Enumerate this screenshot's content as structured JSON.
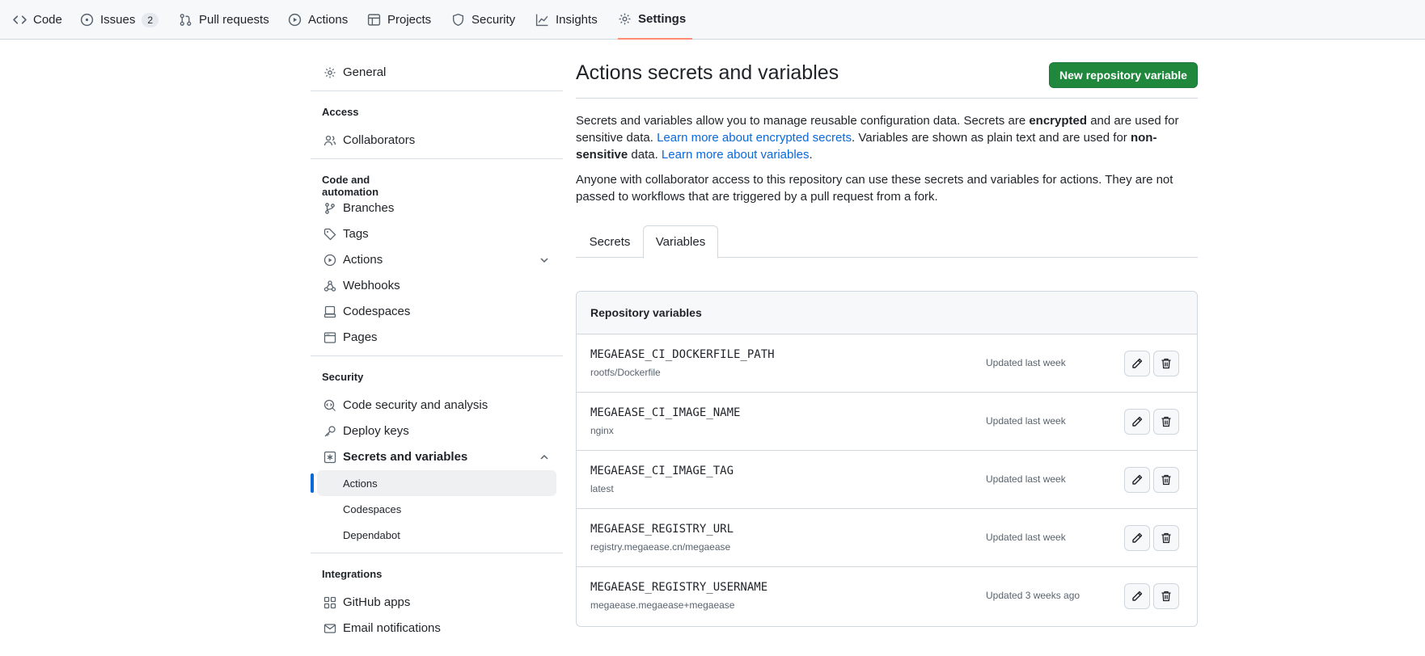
{
  "topnav": {
    "tabs": [
      {
        "label": "Code",
        "icon": "code-icon"
      },
      {
        "label": "Issues",
        "icon": "issue-icon",
        "count": "2"
      },
      {
        "label": "Pull requests",
        "icon": "pull-request-icon"
      },
      {
        "label": "Actions",
        "icon": "play-icon"
      },
      {
        "label": "Projects",
        "icon": "table-icon"
      },
      {
        "label": "Security",
        "icon": "shield-icon"
      },
      {
        "label": "Insights",
        "icon": "graph-icon"
      },
      {
        "label": "Settings",
        "icon": "gear-icon",
        "selected": true
      }
    ]
  },
  "sidebar": {
    "general": "General",
    "access_heading": "Access",
    "collaborators": "Collaborators",
    "code_heading": "Code and automation",
    "branches": "Branches",
    "tags": "Tags",
    "actions": "Actions",
    "webhooks": "Webhooks",
    "codespaces": "Codespaces",
    "pages": "Pages",
    "security_heading": "Security",
    "code_security": "Code security and analysis",
    "deploy_keys": "Deploy keys",
    "secrets_vars": "Secrets and variables",
    "sub_actions": "Actions",
    "sub_codespaces": "Codespaces",
    "sub_dependabot": "Dependabot",
    "integrations_heading": "Integrations",
    "github_apps": "GitHub apps",
    "email_notifications": "Email notifications"
  },
  "main": {
    "title": "Actions secrets and variables",
    "new_button": "New repository variable",
    "p1_a": "Secrets and variables allow you to manage reusable configuration data. Secrets are ",
    "p1_b": "encrypted",
    "p1_c": " and are used for sensitive data. ",
    "p1_link1": "Learn more about encrypted secrets",
    "p1_d": ". Variables are shown as plain text and are used for ",
    "p1_e": "non-sensitive",
    "p1_f": " data. ",
    "p1_link2": "Learn more about variables",
    "p1_g": ".",
    "p2": "Anyone with collaborator access to this repository can use these secrets and variables for actions. They are not passed to workflows that are triggered by a pull request from a fork.",
    "tab_secrets": "Secrets",
    "tab_variables": "Variables",
    "box_title": "Repository variables",
    "variables": [
      {
        "name": "MEGAEASE_CI_DOCKERFILE_PATH",
        "value": "rootfs/Dockerfile",
        "updated": "Updated last week"
      },
      {
        "name": "MEGAEASE_CI_IMAGE_NAME",
        "value": "nginx",
        "updated": "Updated last week"
      },
      {
        "name": "MEGAEASE_CI_IMAGE_TAG",
        "value": "latest",
        "updated": "Updated last week"
      },
      {
        "name": "MEGAEASE_REGISTRY_URL",
        "value": "registry.megaease.cn/megaease",
        "updated": "Updated last week"
      },
      {
        "name": "MEGAEASE_REGISTRY_USERNAME",
        "value": "megaease.megaease+megaease",
        "updated": "Updated 3 weeks ago"
      }
    ]
  }
}
